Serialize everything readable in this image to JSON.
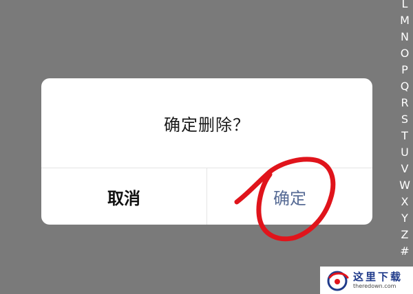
{
  "index_bar": {
    "letters": [
      "L",
      "M",
      "N",
      "O",
      "P",
      "Q",
      "R",
      "S",
      "T",
      "U",
      "V",
      "W",
      "X",
      "Y",
      "Z",
      "#"
    ]
  },
  "dialog": {
    "message": "确定删除？",
    "cancel_label": "取消",
    "confirm_label": "确定"
  },
  "colors": {
    "overlay": "#7a7a7a",
    "confirm_text": "#576b95",
    "annotation": "#e0141b"
  },
  "watermark": {
    "text": "这里下载",
    "url": "theredown.com"
  }
}
